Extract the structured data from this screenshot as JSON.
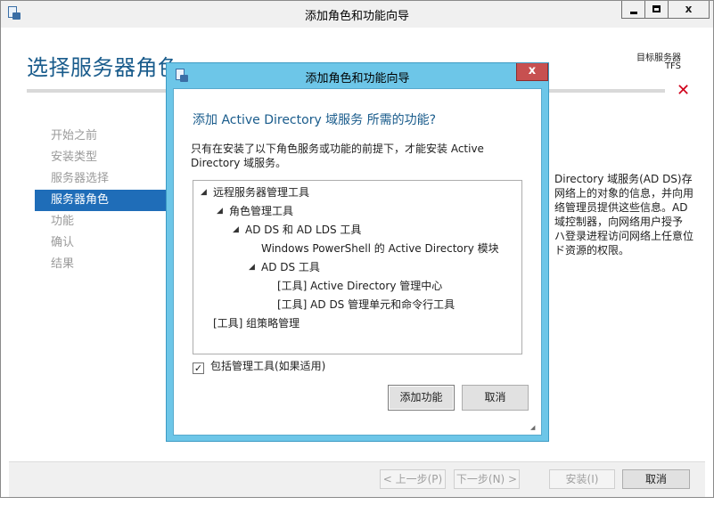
{
  "main_window": {
    "title": "添加角色和功能向导",
    "controls": {
      "minimize": "–",
      "maximize": "□",
      "close": "x"
    },
    "page_title": "选择服务器角色",
    "target_server": {
      "label": "目标服务器",
      "value": "TFS"
    },
    "alert_icon": "red-x-icon",
    "nav_items": [
      {
        "label": "开始之前",
        "state": "inactive"
      },
      {
        "label": "安装类型",
        "state": "inactive"
      },
      {
        "label": "服务器选择",
        "state": "inactive"
      },
      {
        "label": "服务器角色",
        "state": "active"
      },
      {
        "label": "功能",
        "state": "inactive"
      },
      {
        "label": "确认",
        "state": "inactive"
      },
      {
        "label": "结果",
        "state": "inactive"
      }
    ],
    "description_lines": [
      "Directory 域服务(AD DS)存",
      "网络上的对象的信息，并向用",
      "络管理员提供这些信息。AD",
      "域控制器，向网络用户授予",
      "ハ登录进程访问网络上任意位",
      "ド资源的权限。"
    ],
    "footer": {
      "prev": "< 上一步(P)",
      "next": "下一步(N) >",
      "install": "安装(I)",
      "cancel": "取消"
    }
  },
  "dialog": {
    "title": "添加角色和功能向导",
    "close": "x",
    "heading": "添加 Active Directory 域服务 所需的功能?",
    "note": "只有在安装了以下角色服务或功能的前提下，才能安装 Active Directory 域服务。",
    "tree": [
      {
        "label": "远程服务器管理工具",
        "expander": "◢"
      },
      {
        "label": "角色管理工具",
        "expander": "◢"
      },
      {
        "label": "AD DS 和 AD LDS 工具",
        "expander": "◢"
      },
      {
        "label": "Windows PowerShell 的 Active Directory 模块",
        "expander": ""
      },
      {
        "label": "AD DS 工具",
        "expander": "◢"
      },
      {
        "label": "[工具] Active Directory 管理中心",
        "expander": ""
      },
      {
        "label": "[工具] AD DS 管理单元和命令行工具",
        "expander": ""
      },
      {
        "label": "[工具] 组策略管理",
        "expander": ""
      }
    ],
    "include_tools": {
      "label": "包括管理工具(如果适用)",
      "checked": true,
      "mark": "✓"
    },
    "buttons": {
      "add": "添加功能",
      "cancel": "取消"
    }
  },
  "colors": {
    "accent_blue": "#1f6db8",
    "heading_blue": "#1a5c8c",
    "dialog_frame": "#6dc6e8",
    "close_red": "#c75050",
    "alert_red": "#d0021b"
  }
}
